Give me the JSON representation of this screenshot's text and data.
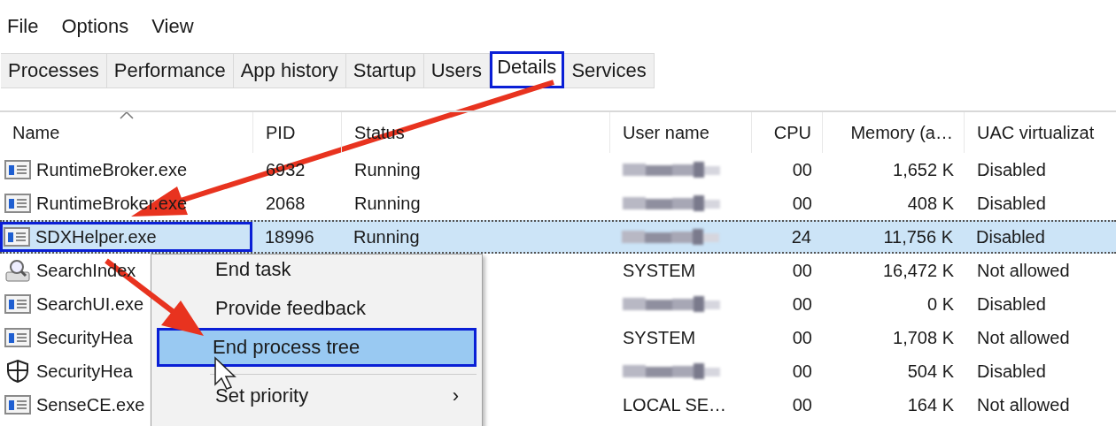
{
  "menu": [
    "File",
    "Options",
    "View"
  ],
  "tabs": [
    {
      "label": "Processes",
      "selected": false,
      "outlined": false
    },
    {
      "label": "Performance",
      "selected": false,
      "outlined": false
    },
    {
      "label": "App history",
      "selected": false,
      "outlined": false
    },
    {
      "label": "Startup",
      "selected": false,
      "outlined": false
    },
    {
      "label": "Users",
      "selected": false,
      "outlined": false
    },
    {
      "label": "Details",
      "selected": true,
      "outlined": true
    },
    {
      "label": "Services",
      "selected": false,
      "outlined": false
    }
  ],
  "table": {
    "columns": [
      {
        "label": "Name",
        "sorted": true
      },
      {
        "label": "PID",
        "sorted": false
      },
      {
        "label": "Status",
        "sorted": false
      },
      {
        "label": "User name",
        "sorted": false
      },
      {
        "label": "CPU",
        "sorted": false
      },
      {
        "label": "Memory (a…",
        "sorted": false
      },
      {
        "label": "UAC virtualizat",
        "sorted": false
      }
    ],
    "rows": [
      {
        "kind": "app",
        "name": "RuntimeBroker.exe",
        "pid": "6932",
        "status": "Running",
        "user_redacted": true,
        "cpu": "00",
        "memory": "1,652 K",
        "uac": "Disabled",
        "selected": false,
        "outlined": false
      },
      {
        "kind": "app",
        "name": "RuntimeBroker.exe",
        "pid": "2068",
        "status": "Running",
        "user_redacted": true,
        "cpu": "00",
        "memory": "408 K",
        "uac": "Disabled",
        "selected": false,
        "outlined": false
      },
      {
        "kind": "app",
        "name": "SDXHelper.exe",
        "pid": "18996",
        "status": "Running",
        "user_redacted": true,
        "cpu": "24",
        "memory": "11,756 K",
        "uac": "Disabled",
        "selected": true,
        "outlined": true
      },
      {
        "kind": "search",
        "name": "SearchIndex",
        "user": "SYSTEM",
        "cpu": "00",
        "memory": "16,472 K",
        "uac": "Not allowed",
        "selected": false,
        "outlined": false
      },
      {
        "kind": "app",
        "name": "SearchUI.exe",
        "user_redacted": true,
        "cpu": "00",
        "memory": "0 K",
        "uac": "Disabled",
        "selected": false,
        "outlined": false
      },
      {
        "kind": "app",
        "name": "SecurityHea",
        "user": "SYSTEM",
        "cpu": "00",
        "memory": "1,708 K",
        "uac": "Not allowed",
        "selected": false,
        "outlined": false
      },
      {
        "kind": "shield",
        "name": "SecurityHea",
        "user_redacted": true,
        "cpu": "00",
        "memory": "504 K",
        "uac": "Disabled",
        "selected": false,
        "outlined": false
      },
      {
        "kind": "app",
        "name": "SenseCE.exe",
        "user": "LOCAL SE…",
        "cpu": "00",
        "memory": "164 K",
        "uac": "Not allowed",
        "selected": false,
        "outlined": false
      }
    ]
  },
  "context_menu": {
    "items": [
      {
        "label": "End task",
        "selected": false
      },
      {
        "label": "Provide feedback",
        "selected": false
      },
      {
        "label": "End process tree",
        "selected": true,
        "separator_after": true
      },
      {
        "label": "Set priority",
        "selected": false,
        "submenu_glyph": "›"
      }
    ]
  }
}
